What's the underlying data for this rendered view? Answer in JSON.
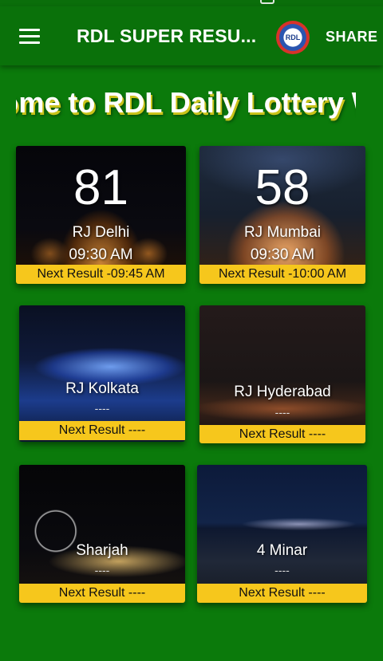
{
  "appbar": {
    "title": "RDL SUPER RESU...",
    "logo_text": "RDL",
    "share_label": "SHARE",
    "menu_icon": "hamburger-menu-icon"
  },
  "marquee": {
    "text": "Welcome to RDL Daily Lottery World"
  },
  "cards": [
    {
      "city": "RJ Delhi",
      "number": "81",
      "time": "09:30 AM",
      "next": "Next Result -09:45 AM"
    },
    {
      "city": "RJ Mumbai",
      "number": "58",
      "time": "09:30 AM",
      "next": "Next Result -10:00 AM"
    },
    {
      "city": "RJ Kolkata",
      "placeholder": "----",
      "next": "Next Result ----"
    },
    {
      "city": "RJ Hyderabad",
      "placeholder": "----",
      "next": "Next Result ----"
    },
    {
      "city": "Sharjah",
      "placeholder": "----",
      "next": "Next Result ----"
    },
    {
      "city": "4 Minar",
      "placeholder": "----",
      "next": "Next Result ----"
    }
  ],
  "colors": {
    "background": "#0b7a0b",
    "appbar": "#0a710a",
    "result_bar": "#f6c71c"
  }
}
